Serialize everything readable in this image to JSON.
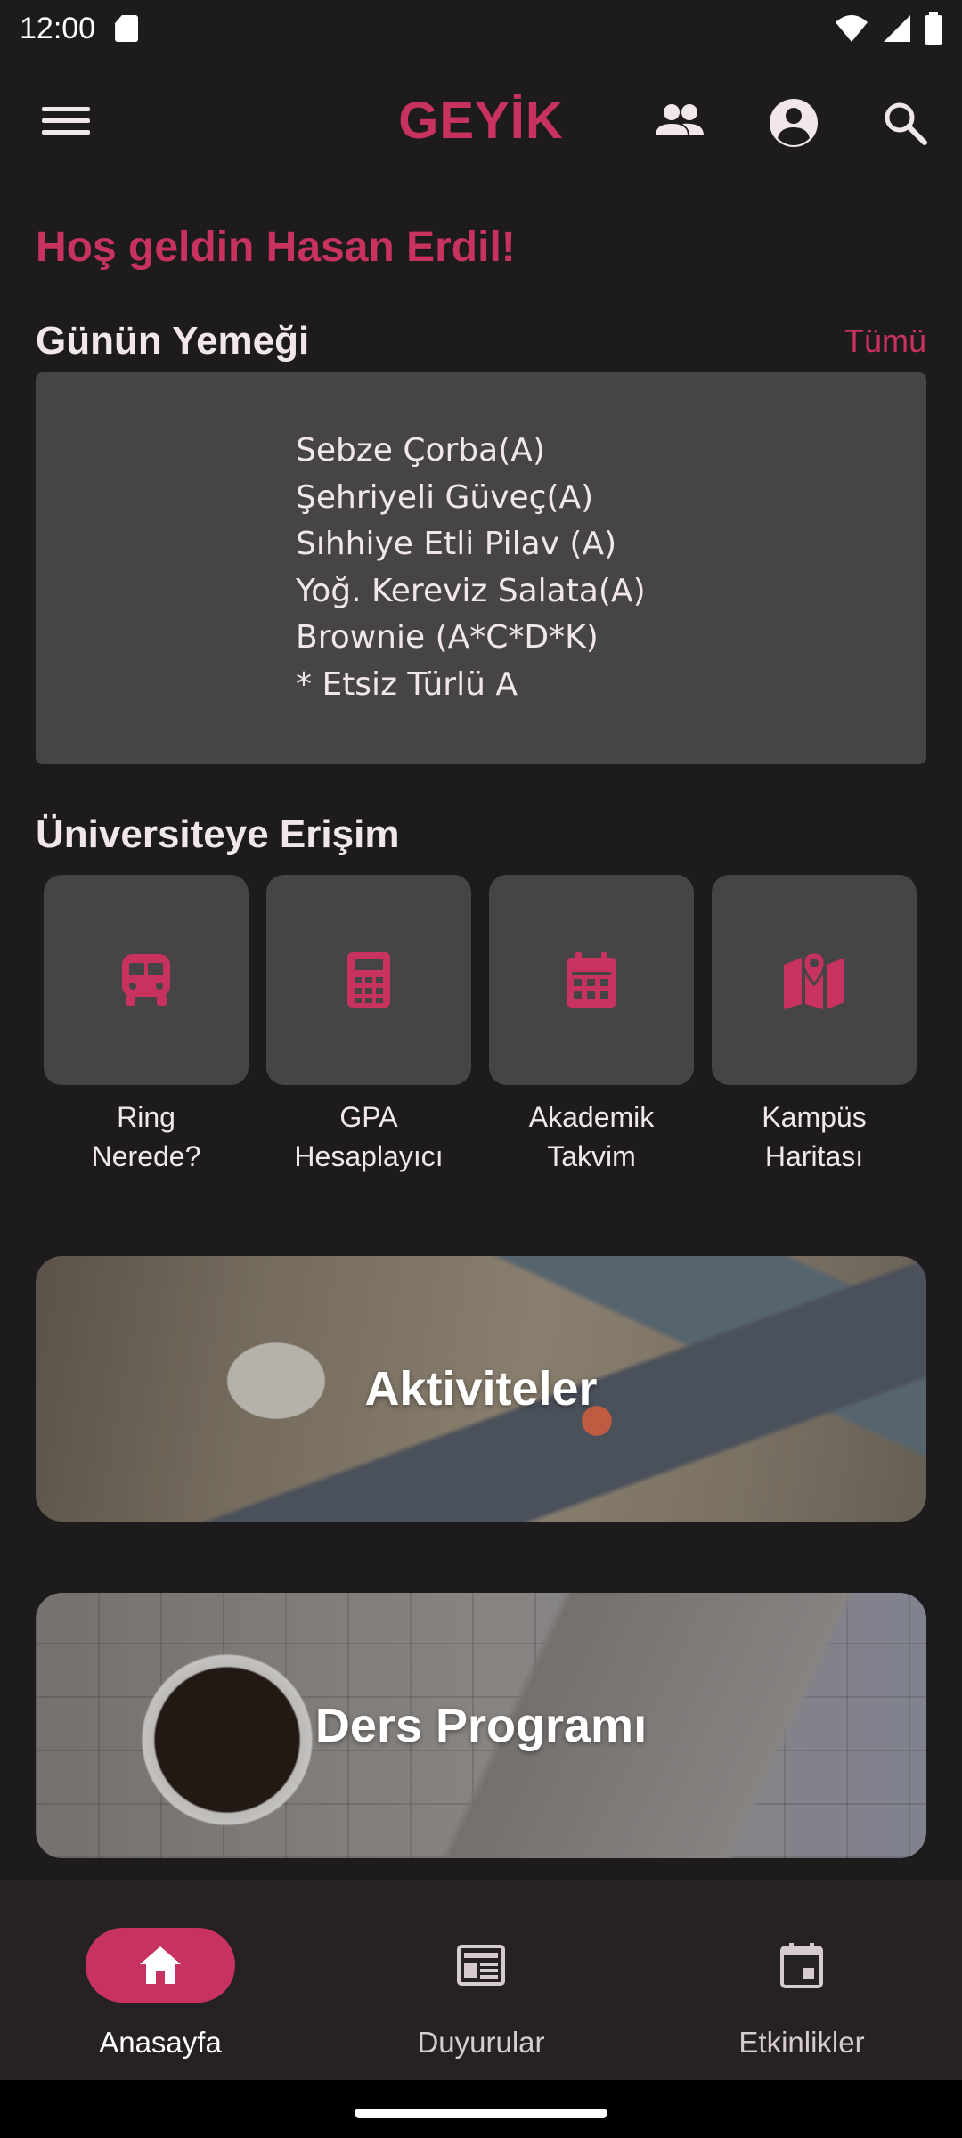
{
  "status_bar": {
    "time": "12:00"
  },
  "app_bar": {
    "title": "GEYİK",
    "icons": [
      "menu-icon",
      "people-icon",
      "account-circle-icon",
      "search-icon"
    ]
  },
  "greeting": "Hoş geldin Hasan Erdil!",
  "meal_section": {
    "title": "Günün Yemeği",
    "see_all": "Tümü",
    "items": [
      "Sebze Çorba(A)",
      "Şehriyeli Güveç(A)",
      "Sıhhiye Etli Pilav (A)",
      "Yoğ. Kereviz Salata(A)",
      "Brownie (A*C*D*K)",
      "* Etsiz Türlü A"
    ]
  },
  "access_section": {
    "title": "Üniversiteye Erişim",
    "items": [
      {
        "line1": "Ring",
        "line2": "Nerede?",
        "icon": "bus-icon"
      },
      {
        "line1": "GPA",
        "line2": "Hesaplayıcı",
        "icon": "calculator-icon"
      },
      {
        "line1": "Akademik",
        "line2": "Takvim",
        "icon": "calendar-icon"
      },
      {
        "line1": "Kampüs",
        "line2": "Haritası",
        "icon": "map-icon"
      }
    ]
  },
  "banners": {
    "activities": "Aktiviteler",
    "schedule": "Ders Programı"
  },
  "bottom_nav": {
    "items": [
      {
        "label": "Anasayfa",
        "icon": "home-icon",
        "active": true
      },
      {
        "label": "Duyurular",
        "icon": "newspaper-icon",
        "active": false
      },
      {
        "label": "Etkinlikler",
        "icon": "event-icon",
        "active": false
      }
    ]
  },
  "colors": {
    "accent": "#c8325f",
    "background": "#1e1b1d",
    "card": "#464446"
  }
}
